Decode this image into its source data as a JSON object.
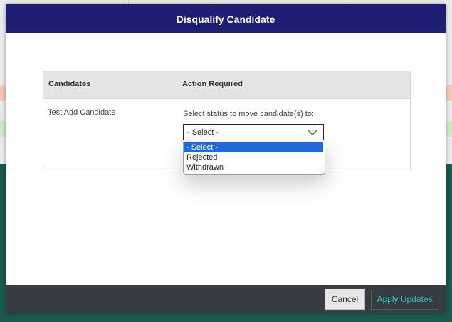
{
  "modal": {
    "title": "Disqualify Candidate"
  },
  "table": {
    "headers": [
      "Candidates",
      "Action Required"
    ],
    "rows": [
      {
        "candidate": "Test Add Candidate",
        "prompt": "Select status to move candidate(s) to:",
        "selected_value": "- Select -"
      }
    ]
  },
  "dropdown": {
    "options": [
      "- Select -",
      "Rejected",
      "Withdrawn"
    ],
    "highlighted_index": 0
  },
  "footer": {
    "cancel_label": "Cancel",
    "apply_label": "Apply Updates"
  },
  "colors": {
    "header_bg": "#1d1d74",
    "footer_bg": "#363c42",
    "apply_text": "#2ec4c4",
    "option_highlight": "#1e6ad6"
  }
}
